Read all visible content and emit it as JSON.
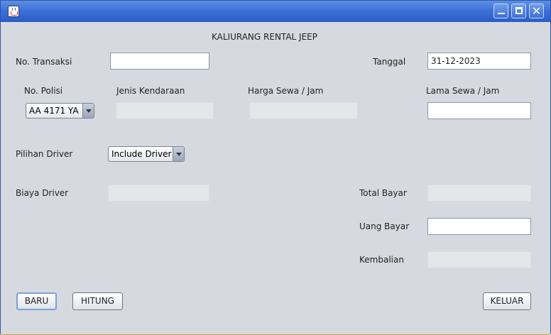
{
  "header": {
    "title": "KALIURANG RENTAL JEEP"
  },
  "transaction": {
    "no_label": "No. Transaksi",
    "no_value": "",
    "date_label": "Tanggal",
    "date_value": "31-12-2023"
  },
  "vehicle": {
    "plate_label": "No. Polisi",
    "plate_selected": "AA 4171 YA",
    "type_label": "Jenis Kendaraan",
    "type_value": "",
    "price_label": "Harga Sewa / Jam",
    "price_value": "",
    "duration_label": "Lama Sewa / Jam",
    "duration_value": ""
  },
  "driver": {
    "option_label": "Pilihan Driver",
    "option_selected": "Include Driver",
    "cost_label": "Biaya Driver",
    "cost_value": ""
  },
  "payment": {
    "total_label": "Total Bayar",
    "total_value": "",
    "paid_label": "Uang Bayar",
    "paid_value": "",
    "change_label": "Kembalian",
    "change_value": ""
  },
  "buttons": {
    "new": "BARU",
    "calculate": "HITUNG",
    "exit": "KELUAR"
  },
  "colors": {
    "titlebar": "#3e72d8",
    "panel": "#d6d9df"
  }
}
